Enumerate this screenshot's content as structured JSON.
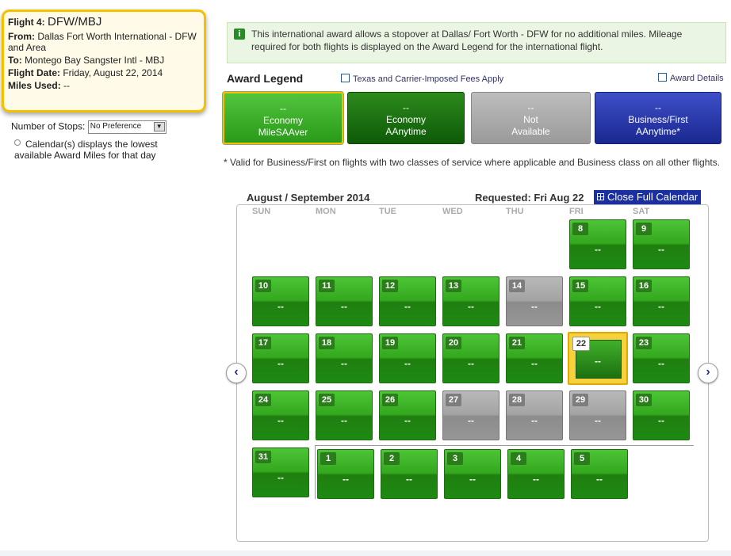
{
  "flight": {
    "label": "Flight 4:",
    "route": "DFW/MBJ",
    "from_label": "From:",
    "from": "Dallas Fort Worth International - DFW and Area",
    "to_label": "To:",
    "to": "Montego Bay Sangster Intl - MBJ",
    "date_label": "Flight Date:",
    "date": "Friday, August 22, 2014",
    "miles_label": "Miles Used:",
    "miles": "--"
  },
  "stops": {
    "label": "Number of Stops:",
    "value": "No Preference"
  },
  "calendar_note": "Calendar(s) displays the lowest available Award Miles for that day",
  "info": {
    "icon": "info-icon",
    "text": "This international award allows a stopover at Dallas/ Fort Worth - DFW for no additional miles. Mileage required for both flights is displayed on the Award Legend for the international flight."
  },
  "legend": {
    "title": "Award Legend",
    "taxes_link": "Texas and Carrier-Imposed Fees Apply",
    "details_link": "Award Details",
    "items": [
      {
        "value": "--",
        "line1": "Economy",
        "line2": "MileSAAver"
      },
      {
        "value": "--",
        "line1": "Economy",
        "line2": "AAnytime"
      },
      {
        "value": "--",
        "line1": "Not",
        "line2": "Available"
      },
      {
        "value": "--",
        "line1": "Business/First",
        "line2": "AAnytime*"
      }
    ],
    "footnote": "* Valid for Business/First on flights with two classes of service where applicable and Business class on all other flights."
  },
  "calendar": {
    "title": "August / September 2014",
    "requested": "Requested: Fri Aug 22",
    "close_label": "Close Full Calendar",
    "weekdays": [
      "SUN",
      "MON",
      "TUE",
      "WED",
      "THU",
      "FRI",
      "SAT"
    ],
    "days": [
      {
        "day": "8",
        "value": "--",
        "status": "green"
      },
      {
        "day": "9",
        "value": "--",
        "status": "green"
      },
      {
        "day": "10",
        "value": "--",
        "status": "green"
      },
      {
        "day": "11",
        "value": "--",
        "status": "green"
      },
      {
        "day": "12",
        "value": "--",
        "status": "green"
      },
      {
        "day": "13",
        "value": "--",
        "status": "green"
      },
      {
        "day": "14",
        "value": "--",
        "status": "gray"
      },
      {
        "day": "15",
        "value": "--",
        "status": "green"
      },
      {
        "day": "16",
        "value": "--",
        "status": "green"
      },
      {
        "day": "17",
        "value": "--",
        "status": "green"
      },
      {
        "day": "18",
        "value": "--",
        "status": "green"
      },
      {
        "day": "19",
        "value": "--",
        "status": "green"
      },
      {
        "day": "20",
        "value": "--",
        "status": "green"
      },
      {
        "day": "21",
        "value": "--",
        "status": "green"
      },
      {
        "day": "22",
        "value": "--",
        "status": "selected"
      },
      {
        "day": "23",
        "value": "--",
        "status": "green"
      },
      {
        "day": "24",
        "value": "--",
        "status": "green"
      },
      {
        "day": "25",
        "value": "--",
        "status": "green"
      },
      {
        "day": "26",
        "value": "--",
        "status": "green"
      },
      {
        "day": "27",
        "value": "--",
        "status": "gray"
      },
      {
        "day": "28",
        "value": "--",
        "status": "gray"
      },
      {
        "day": "29",
        "value": "--",
        "status": "gray"
      },
      {
        "day": "30",
        "value": "--",
        "status": "green"
      },
      {
        "day": "31",
        "value": "--",
        "status": "green"
      },
      {
        "day": "1",
        "value": "--",
        "status": "green"
      },
      {
        "day": "2",
        "value": "--",
        "status": "green"
      },
      {
        "day": "3",
        "value": "--",
        "status": "green"
      },
      {
        "day": "4",
        "value": "--",
        "status": "green"
      },
      {
        "day": "5",
        "value": "--",
        "status": "green"
      }
    ]
  },
  "nav": {
    "prev": "‹",
    "next": "›"
  }
}
